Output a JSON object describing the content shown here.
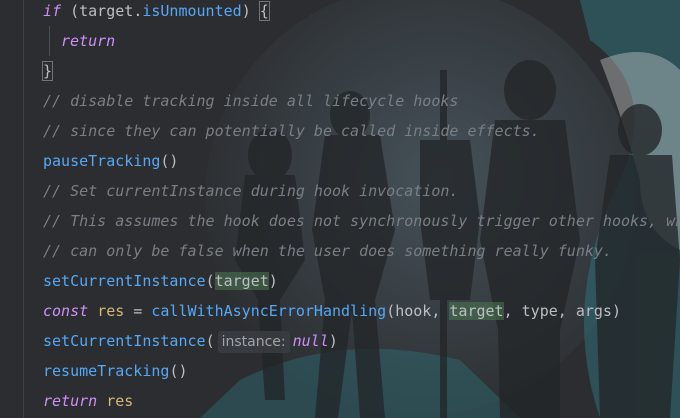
{
  "editor": {
    "language": "typescript",
    "colors": {
      "background": "#2b2d30",
      "keyword": "#cf8efa",
      "function": "#56a8f5",
      "variable": "#d5b778",
      "comment": "#7a7e85",
      "plain": "#bcbec4"
    },
    "lines": [
      {
        "kw": "if",
        "p1": " (",
        "obj": "target",
        "dot": ".",
        "prop": "isUnmounted",
        "p2": ") ",
        "brace": "{"
      },
      {
        "kw": "return"
      },
      {
        "brace": "}"
      },
      {
        "comment": "// disable tracking inside all lifecycle hooks"
      },
      {
        "comment": "// since they can potentially be called inside effects."
      },
      {
        "fn": "pauseTracking",
        "rest": "()"
      },
      {
        "comment": "// Set currentInstance during hook invocation."
      },
      {
        "comment": "// This assumes the hook does not synchronously trigger other hooks, which"
      },
      {
        "comment": "// can only be false when the user does something really funky."
      },
      {
        "fn": "setCurrentInstance",
        "open": "(",
        "arg": "target",
        "close": ")"
      },
      {
        "kw": "const",
        "var": "res",
        "eq": " = ",
        "fn": "callWithAsyncErrorHandling",
        "a1": "(hook, ",
        "a2": "target",
        "a3": ", type, args)"
      },
      {
        "fn": "setCurrentInstance",
        "open": "(",
        "hint": "instance:",
        "nullv": "null",
        "close": ")"
      },
      {
        "fn": "resumeTracking",
        "rest": "()"
      },
      {
        "kw": "return",
        "var": "res"
      }
    ]
  }
}
